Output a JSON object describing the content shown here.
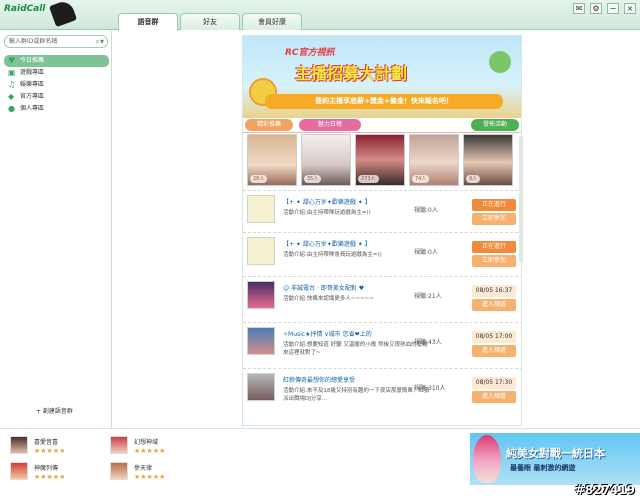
{
  "app": {
    "logo_text": "RaidCall"
  },
  "tabs": [
    {
      "label": "語音群"
    },
    {
      "label": "好友"
    },
    {
      "label": "會員好康"
    }
  ],
  "search": {
    "placeholder": "輸入群ID或群名稱"
  },
  "nav": [
    {
      "label": "今日推薦"
    },
    {
      "label": "遊戲專區"
    },
    {
      "label": "娛樂專區"
    },
    {
      "label": "官方專區"
    },
    {
      "label": "個人專區"
    }
  ],
  "new_channel": "+ 創建語音群",
  "banner": {
    "title": "RC官方視訊",
    "main": "主播招募大計劃",
    "sub": "簽約主播享底薪+獎金+傭金！快來報名吧！"
  },
  "filters": {
    "pick": "精彩推薦",
    "charm": "魅力日榜",
    "event": "發佈活動"
  },
  "avatars": [
    "28人",
    "35人",
    "273人",
    "74人",
    "9人"
  ],
  "events": [
    {
      "title": "【+ ✦ 甜心万岁✦歡樂遊戲 ✦ 】",
      "desc": "活動介紹:由主持帶隊玩遊戲為主=))",
      "viewers": "視聽:0人",
      "badge": "正在進行",
      "button": "立即參加"
    },
    {
      "title": "【+ ✦ 甜心万岁✦歡樂遊戲 ✦ 】",
      "desc": "活動介紹:由主持帶隊會員玩遊戲為主=))",
      "viewers": "視聽:0人",
      "badge": "正在進行",
      "button": "立即參加"
    },
    {
      "title": "☺ 非誠電台 · 即哥美女配對 ♥",
      "desc": "活動介紹:快瘋來認識更多人~~~~~",
      "viewers": "視聽:21人",
      "badge": "08/05 16:37",
      "button": "進入頻道"
    },
    {
      "title": "✧Music★抒情 ∨城市 您省❤上的",
      "desc": "活動介紹:想要知道 好聽 又溫暖的小歌 然後又很熱血的廢雞 來這裡就對了~",
      "viewers": "視聽:43人",
      "badge": "08/05 17:00",
      "button": "進入頻道"
    },
    {
      "title": "紅狼傳奇最想你的總愛享受",
      "desc": "活動介紹:來不及18歲又特別有趣的一下夜店那麼簡單！紅狼派出職場DJ分享...",
      "viewers": "視聽:310人",
      "badge": "08/05 17:30",
      "button": "進入頻道"
    }
  ],
  "bottom_games": [
    {
      "name": "喜愛音喜"
    },
    {
      "name": "幻想神域"
    },
    {
      "name": "神魔列傳"
    },
    {
      "name": "參天律"
    }
  ],
  "ad": {
    "title": "純美女對戰一統日本",
    "sub": "最養眼 最刺激的網遊"
  },
  "watermark": "#827419"
}
